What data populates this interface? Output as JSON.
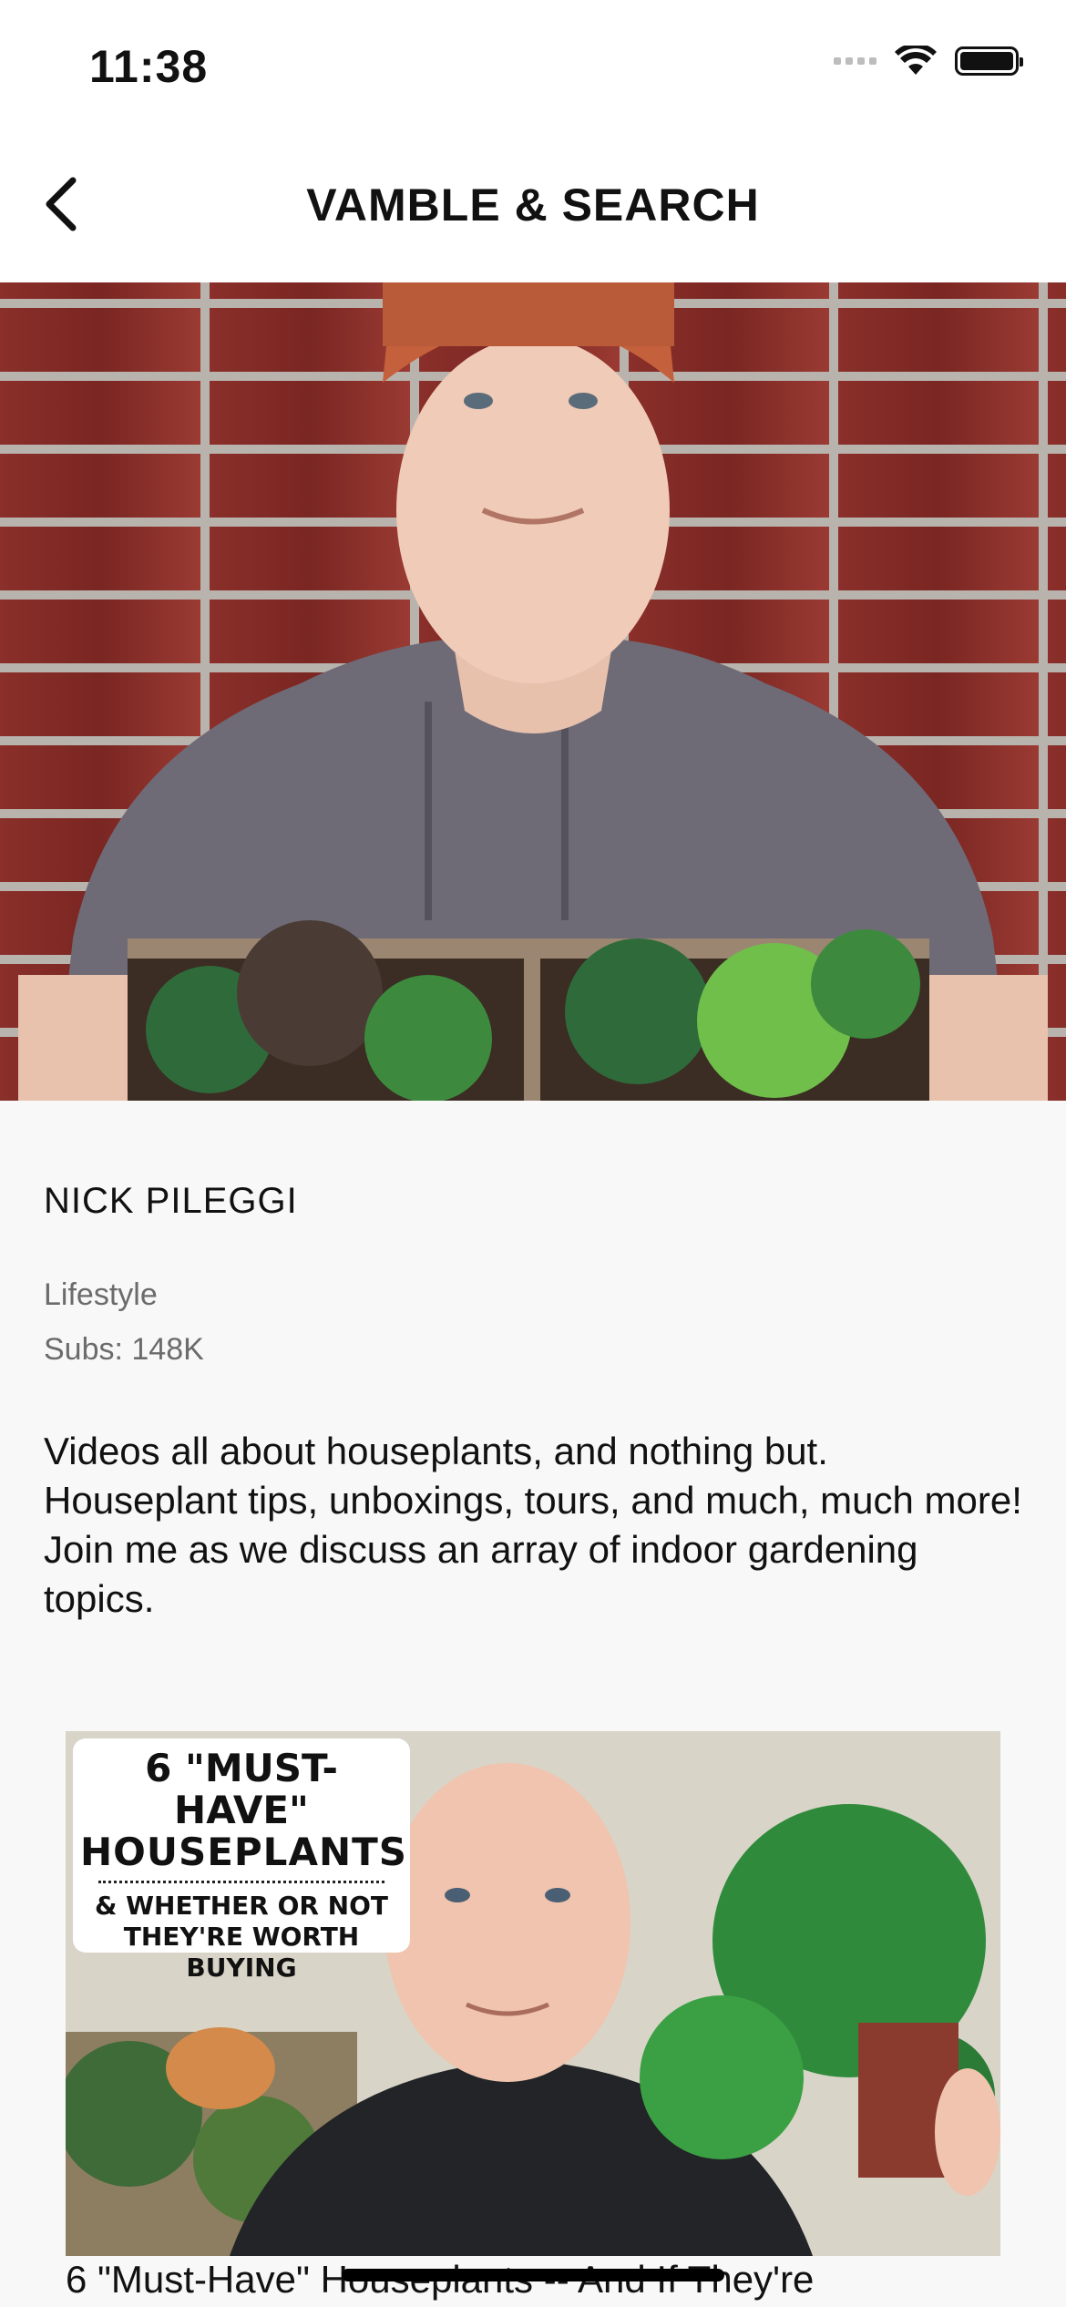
{
  "status_bar": {
    "time": "11:38"
  },
  "nav": {
    "title": "VAMBLE & SEARCH"
  },
  "channel": {
    "name": "NICK PILEGGI",
    "category": "Lifestyle",
    "subs": "Subs: 148K",
    "description": "Videos all about houseplants, and nothing but. Houseplant tips, unboxings, tours, and much, much more! Join me as we discuss an array of indoor gardening topics."
  },
  "video": {
    "thumbnail_line1": "6 \"MUST-HAVE\"",
    "thumbnail_line2": "HOUSEPLANTS",
    "thumbnail_line3": "& WHETHER OR NOT",
    "thumbnail_line4": "THEY'RE WORTH BUYING",
    "title": "6 \"Must-Have\" Houseplants -- And If They're"
  }
}
